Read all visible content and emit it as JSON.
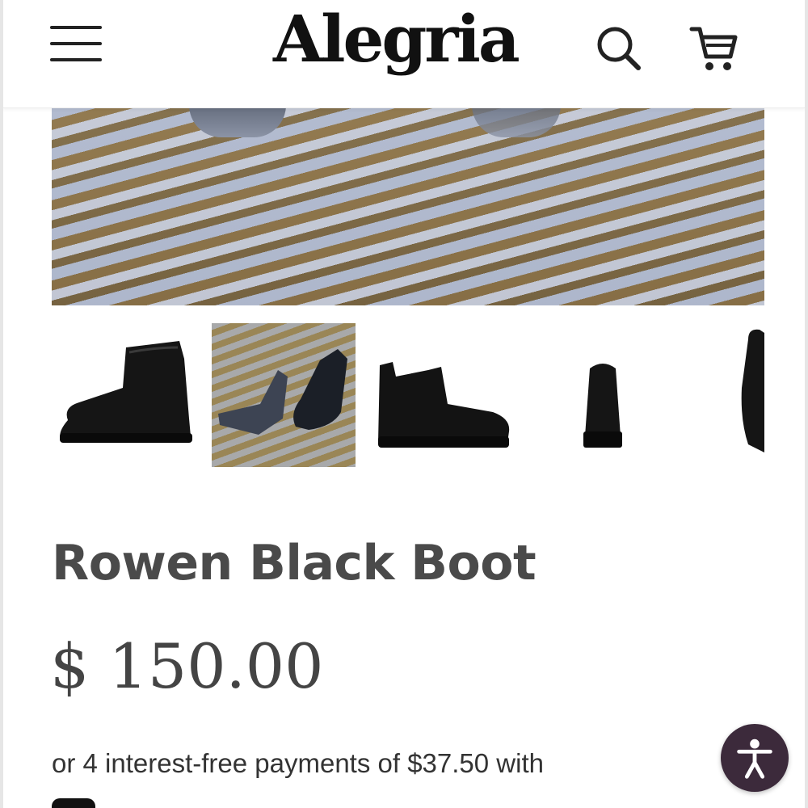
{
  "header": {
    "logo_text": "Alegria",
    "icons": {
      "menu": "menu-icon",
      "search": "search-icon",
      "cart": "cart-icon"
    }
  },
  "gallery": {
    "hero_alt": "boots in shallow water",
    "thumbnails": [
      {
        "name": "boot-side-view"
      },
      {
        "name": "boots-in-water",
        "active": true
      },
      {
        "name": "boot-side-view-2"
      },
      {
        "name": "boot-back-view"
      },
      {
        "name": "boot-partial-view"
      }
    ]
  },
  "product": {
    "title": "Rowen Black Boot",
    "price": "$ 150.00",
    "installments_text": "or 4 interest-free payments of $37.50 with"
  },
  "accessibility": {
    "icon": "accessibility-icon"
  },
  "colors": {
    "text": "#4a4a4a",
    "accent": "#3c2a3b",
    "logo": "#111111"
  }
}
